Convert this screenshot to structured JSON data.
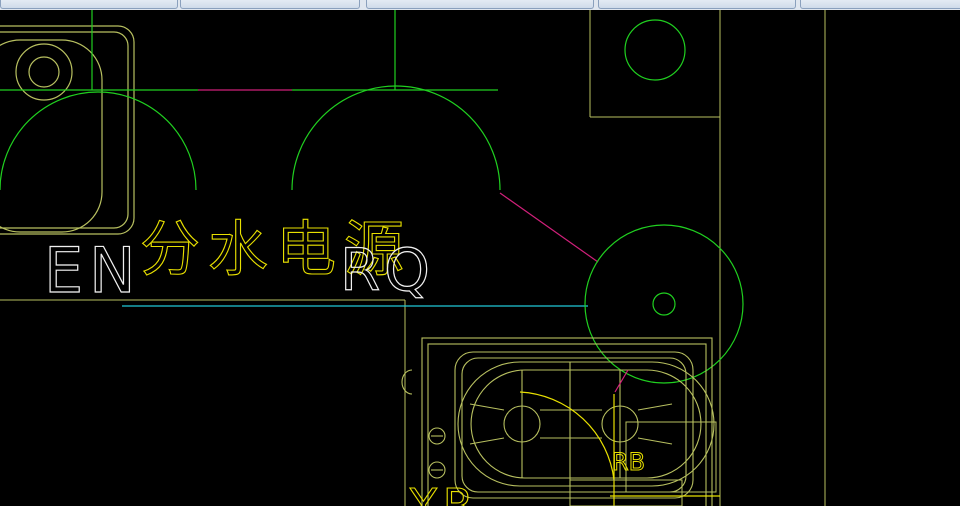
{
  "tabs": [
    {
      "label": "",
      "active": false
    },
    {
      "label": "",
      "active": false
    },
    {
      "label": "",
      "active": false
    },
    {
      "label": "",
      "active": false
    },
    {
      "label": "",
      "active": false
    }
  ],
  "drawing": {
    "background": "#000000",
    "labels": {
      "left_text": "EN",
      "chinese_text": "分水电源",
      "right_text": "RQ",
      "small_text": "RB",
      "partial_text": "YR"
    },
    "colors": {
      "green": "#20d020",
      "yellow": "#e8e000",
      "magenta": "#d0207a",
      "cyan": "#20c8d8",
      "white": "#f0f0f0",
      "olive": "#b8c060",
      "light_green": "#80c060"
    }
  }
}
